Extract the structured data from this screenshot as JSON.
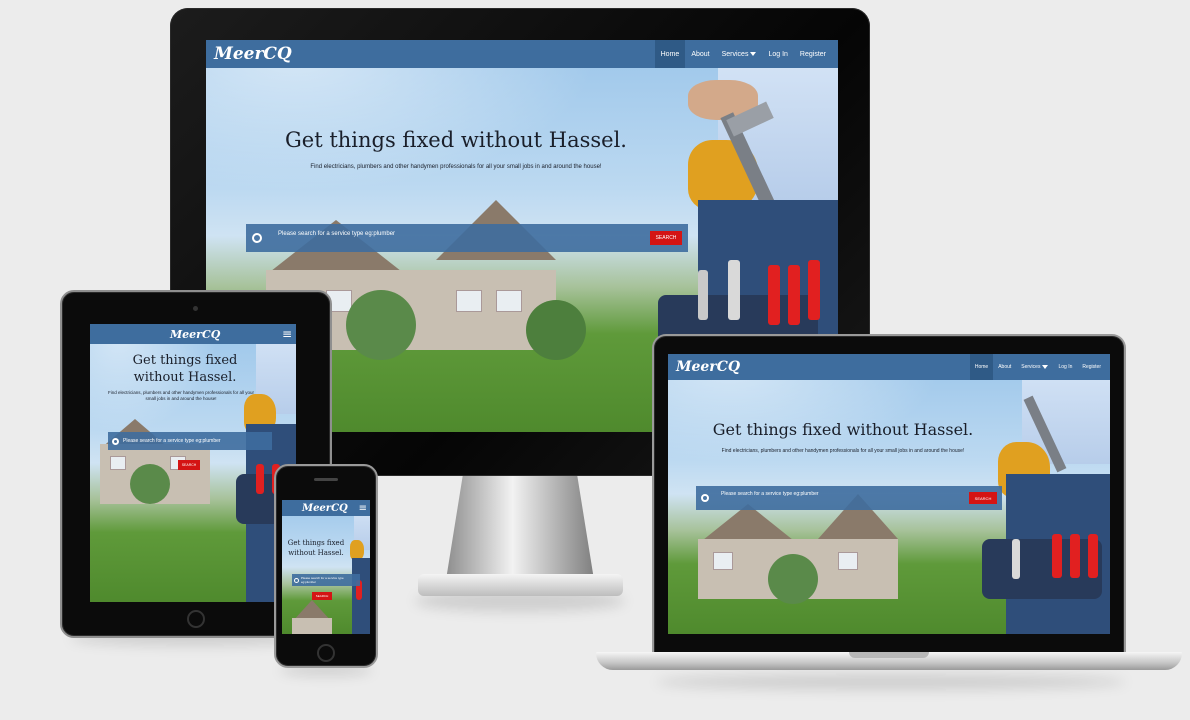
{
  "site": {
    "brand": "MeerCQ",
    "nav": {
      "home": "Home",
      "about": "About",
      "services": "Services",
      "login": "Log In",
      "register": "Register"
    },
    "menu_icon": "≡",
    "hero": {
      "title": "Get things fixed without Hassel.",
      "subtitle": "Find electricians, plumbers and other handymen professionals for all your small jobs in and around the house!",
      "search_placeholder": "Please search for a service type eg:plumber",
      "search_button": "SEARCH"
    },
    "tablet_title_line1": "Get things fixed",
    "tablet_title_line2": "without Hassel.",
    "phone_title_line1": "Get things fixed",
    "phone_title_line2": "without Hassel."
  },
  "icons": {
    "search": "search-icon",
    "menu": "hamburger-menu-icon",
    "caret": "chevron-down-icon"
  },
  "colors": {
    "navbar": "#3e6d9e",
    "search_button": "#d41414",
    "background": "#ececec"
  }
}
